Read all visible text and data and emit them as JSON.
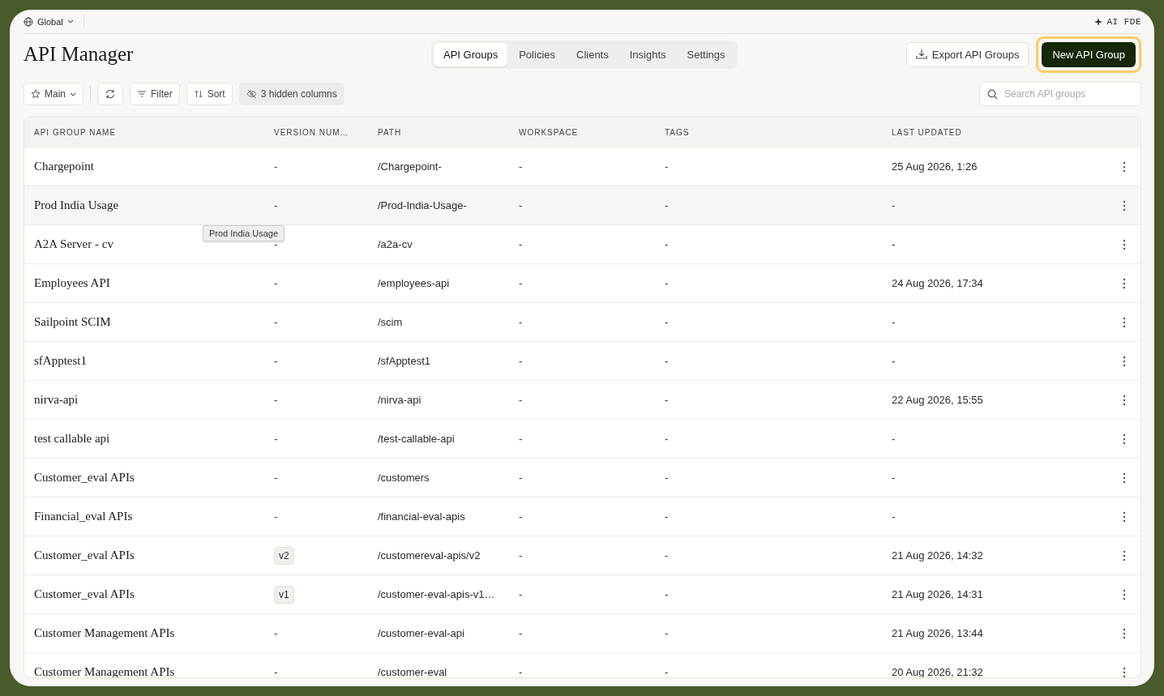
{
  "topbar": {
    "scope": "Global",
    "assistant": "AI FDE"
  },
  "header": {
    "title": "API Manager",
    "export_button": "Export API Groups",
    "new_button": "New API Group",
    "new_button_highlighted": true
  },
  "tabs": [
    {
      "label": "API Groups",
      "selected": true
    },
    {
      "label": "Policies",
      "selected": false
    },
    {
      "label": "Clients",
      "selected": false
    },
    {
      "label": "Insights",
      "selected": false
    },
    {
      "label": "Settings",
      "selected": false
    }
  ],
  "toolbar": {
    "view": "Main",
    "filter": "Filter",
    "sort": "Sort",
    "hidden_columns": "3 hidden columns",
    "search_placeholder": "Search API groups"
  },
  "table": {
    "columns": [
      "API GROUP NAME",
      "VERSION NUM…",
      "PATH",
      "WORKSPACE",
      "TAGS",
      "LAST UPDATED"
    ],
    "rows": [
      {
        "name": "Chargepoint",
        "version": "-",
        "kind": "plain",
        "path": "/Chargepoint-",
        "workspace": "-",
        "tags": "-",
        "updated": "25 Aug 2026, 1:26",
        "hovered": false
      },
      {
        "name": "Prod India Usage",
        "version": "-",
        "kind": "plain",
        "path": "/Prod-India-Usage-",
        "workspace": "-",
        "tags": "-",
        "updated": "-",
        "hovered": true
      },
      {
        "name": "A2A Server - cv",
        "version": "-",
        "kind": "plain",
        "path": "/a2a-cv",
        "workspace": "-",
        "tags": "-",
        "updated": "-",
        "hovered": false
      },
      {
        "name": "Employees API",
        "version": "-",
        "kind": "plain",
        "path": "/employees-api",
        "workspace": "-",
        "tags": "-",
        "updated": "24 Aug 2026, 17:34",
        "hovered": false
      },
      {
        "name": "Sailpoint SCIM",
        "version": "-",
        "kind": "plain",
        "path": "/scim",
        "workspace": "-",
        "tags": "-",
        "updated": "-",
        "hovered": false
      },
      {
        "name": "sfApptest1",
        "version": "-",
        "kind": "plain",
        "path": "/sfApptest1",
        "workspace": "-",
        "tags": "-",
        "updated": "-",
        "hovered": false
      },
      {
        "name": "nirva-api",
        "version": "-",
        "kind": "plain",
        "path": "/nirva-api",
        "workspace": "-",
        "tags": "-",
        "updated": "22 Aug 2026, 15:55",
        "hovered": false
      },
      {
        "name": "test callable api",
        "version": "-",
        "kind": "plain",
        "path": "/test-callable-api",
        "workspace": "-",
        "tags": "-",
        "updated": "-",
        "hovered": false
      },
      {
        "name": "Customer_eval APIs",
        "version": "-",
        "kind": "plain",
        "path": "/customers",
        "workspace": "-",
        "tags": "-",
        "updated": "-",
        "hovered": false
      },
      {
        "name": "Financial_eval APIs",
        "version": "-",
        "kind": "plain",
        "path": "/financial-eval-apis",
        "workspace": "-",
        "tags": "-",
        "updated": "-",
        "hovered": false
      },
      {
        "name": "Customer_eval APIs",
        "version": "v2",
        "kind": "badge",
        "path": "/customereval-apis/v2",
        "workspace": "-",
        "tags": "-",
        "updated": "21 Aug 2026, 14:32",
        "hovered": false
      },
      {
        "name": "Customer_eval APIs",
        "version": "v1",
        "kind": "badge",
        "path": "/customer-eval-apis-v1…",
        "workspace": "-",
        "tags": "-",
        "updated": "21 Aug 2026, 14:31",
        "hovered": false
      },
      {
        "name": "Customer Management APIs",
        "version": "-",
        "kind": "plain",
        "path": "/customer-eval-api",
        "workspace": "-",
        "tags": "-",
        "updated": "21 Aug 2026, 13:44",
        "hovered": false
      },
      {
        "name": "Customer Management APIs",
        "version": "-",
        "kind": "plain",
        "path": "/customer-eval",
        "workspace": "-",
        "tags": "-",
        "updated": "20 Aug 2026, 21:32",
        "hovered": false
      }
    ]
  },
  "tooltip": "Prod India Usage"
}
